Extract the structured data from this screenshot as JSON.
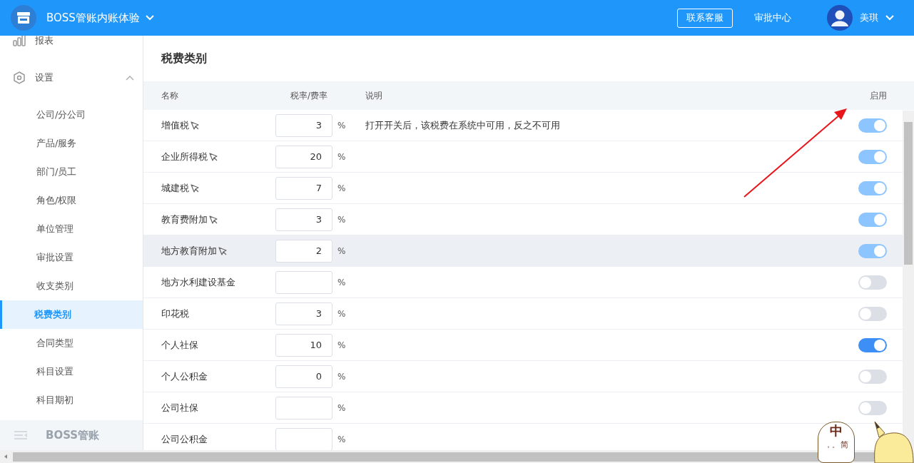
{
  "header": {
    "app_title": "BOSS管账内账体验",
    "support_button": "联系客服",
    "approval_link": "审批中心",
    "user_name": "美琪"
  },
  "sidebar": {
    "items": [
      {
        "label": "报表",
        "selected": false
      },
      {
        "label": "设置",
        "expanded": true,
        "selected": false,
        "children": [
          {
            "label": "公司/分公司",
            "selected": false
          },
          {
            "label": "产品/服务",
            "selected": false
          },
          {
            "label": "部门/员工",
            "selected": false
          },
          {
            "label": "角色/权限",
            "selected": false
          },
          {
            "label": "单位管理",
            "selected": false
          },
          {
            "label": "审批设置",
            "selected": false
          },
          {
            "label": "收支类别",
            "selected": false
          },
          {
            "label": "税费类别",
            "selected": true
          },
          {
            "label": "合同类型",
            "selected": false
          },
          {
            "label": "科目设置",
            "selected": false
          },
          {
            "label": "科目期初",
            "selected": false
          }
        ]
      }
    ],
    "footer": "BOSS管账"
  },
  "page": {
    "title": "税费类别",
    "table": {
      "columns": [
        "名称",
        "税率/费率",
        "说明",
        "启用"
      ],
      "rows": [
        {
          "name": "增值税",
          "pinned": true,
          "rate": "3",
          "unit": "%",
          "note": "打开开关后，该税费在系统中可用，反之不可用",
          "on": true,
          "disabled": true,
          "highlighted": false
        },
        {
          "name": "企业所得税",
          "pinned": true,
          "rate": "20",
          "unit": "%",
          "on": true,
          "disabled": true,
          "highlighted": false
        },
        {
          "name": "城建税",
          "pinned": true,
          "rate": "7",
          "unit": "%",
          "on": true,
          "disabled": true,
          "highlighted": false
        },
        {
          "name": "教育费附加",
          "pinned": true,
          "rate": "3",
          "unit": "%",
          "on": true,
          "disabled": true,
          "highlighted": false
        },
        {
          "name": "地方教育附加",
          "pinned": true,
          "rate": "2",
          "unit": "%",
          "on": true,
          "disabled": true,
          "highlighted": true
        },
        {
          "name": "地方水利建设基金",
          "pinned": false,
          "rate": "",
          "unit": "%",
          "on": false,
          "disabled": false,
          "highlighted": false
        },
        {
          "name": "印花税",
          "pinned": false,
          "rate": "3",
          "unit": "%",
          "on": false,
          "disabled": false,
          "highlighted": false
        },
        {
          "name": "个人社保",
          "pinned": false,
          "rate": "10",
          "unit": "%",
          "on": true,
          "disabled": false,
          "highlighted": false
        },
        {
          "name": "个人公积金",
          "pinned": false,
          "rate": "0",
          "unit": "%",
          "on": false,
          "disabled": false,
          "highlighted": false
        },
        {
          "name": "公司社保",
          "pinned": false,
          "rate": "",
          "unit": "%",
          "on": false,
          "disabled": false,
          "highlighted": false
        },
        {
          "name": "公司公积金",
          "pinned": false,
          "rate": "",
          "unit": "%",
          "highlighted": false
        }
      ]
    }
  },
  "ime_widget": {
    "mode": "中",
    "punctuation": "，。",
    "script": "简"
  }
}
